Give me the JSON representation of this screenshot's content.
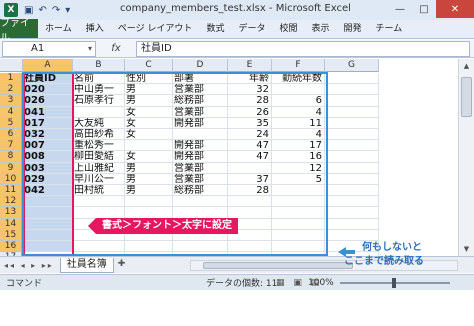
{
  "window": {
    "title": "company_members_test.xlsx - Microsoft Excel",
    "app_icon": "X",
    "qat_icons": [
      "save-icon",
      "undo-icon",
      "redo-icon",
      "customize-icon"
    ],
    "controls": [
      "—",
      "□",
      "✕"
    ]
  },
  "ribbon": {
    "file_tab": "ファイル",
    "tabs": [
      "ホーム",
      "挿入",
      "ページ レイアウト",
      "数式",
      "データ",
      "校閲",
      "表示",
      "開発",
      "チーム"
    ],
    "right_icons": [
      "△",
      "?",
      "—",
      "□",
      "✕"
    ]
  },
  "formula_bar": {
    "name_box": "A1",
    "fx_label": "fx",
    "content": "社員ID"
  },
  "grid": {
    "columns": [
      "A",
      "B",
      "C",
      "D",
      "E",
      "F",
      "G"
    ],
    "rows": [
      "1",
      "2",
      "3",
      "4",
      "5",
      "6",
      "7",
      "8",
      "9",
      "10",
      "11",
      "12",
      "13",
      "14",
      "15",
      "16",
      "17"
    ],
    "data": [
      [
        "社員ID",
        "名前",
        "性別",
        "部署",
        "年齢",
        "勤続年数"
      ],
      [
        "020",
        "中山勇一",
        "男",
        "営業部",
        "32",
        ""
      ],
      [
        "026",
        "石原孝行",
        "男",
        "総務部",
        "28",
        "6"
      ],
      [
        "041",
        "",
        "女",
        "営業部",
        "26",
        "4"
      ],
      [
        "017",
        "大友純",
        "女",
        "開発部",
        "35",
        "11"
      ],
      [
        "032",
        "高田紗希",
        "女",
        "",
        "24",
        "4"
      ],
      [
        "007",
        "重松秀一",
        "",
        "開発部",
        "47",
        "17"
      ],
      [
        "008",
        "柳田愛結",
        "女",
        "開発部",
        "47",
        "16"
      ],
      [
        "003",
        "上山雅紀",
        "男",
        "営業部",
        "",
        "12"
      ],
      [
        "029",
        "早川公一",
        "男",
        "営業部",
        "37",
        "5"
      ],
      [
        "042",
        "田村統",
        "男",
        "総務部",
        "28",
        ""
      ]
    ]
  },
  "sheet_bar": {
    "nav": "◂◂ ◂ ▸ ▸▸",
    "sheet_tab": "社員名簿",
    "new_sheet_icon": "new-sheet-icon"
  },
  "status_bar": {
    "mode": "コマンド",
    "count": "データの個数: 11",
    "zoom": "100%",
    "view_icons": "▦ ▣ ▤"
  },
  "annotations": {
    "red_label": "書式＞フォント＞太字に設定",
    "blue_label_line1": "何もしないと",
    "blue_label_line2": "ここまで読み取る"
  }
}
